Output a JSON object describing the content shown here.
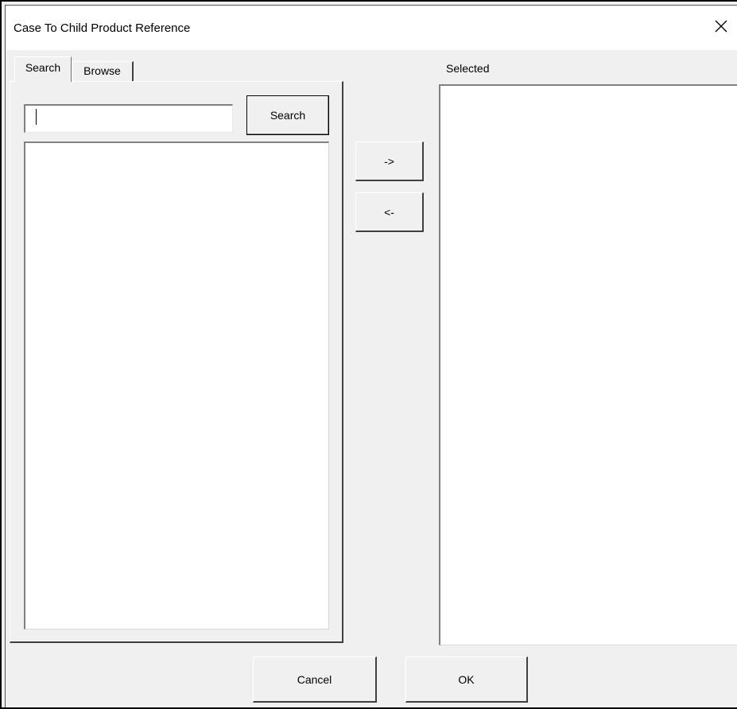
{
  "window": {
    "title": "Case To Child Product Reference",
    "close_icon": "close-icon"
  },
  "tabs": [
    {
      "label": "Search",
      "active": true
    },
    {
      "label": "Browse",
      "active": false
    }
  ],
  "search": {
    "value": "",
    "button_label": "Search"
  },
  "transfer": {
    "add_label": "->",
    "remove_label": "<-"
  },
  "selected": {
    "label": "Selected"
  },
  "footer": {
    "cancel_label": "Cancel",
    "ok_label": "OK"
  }
}
